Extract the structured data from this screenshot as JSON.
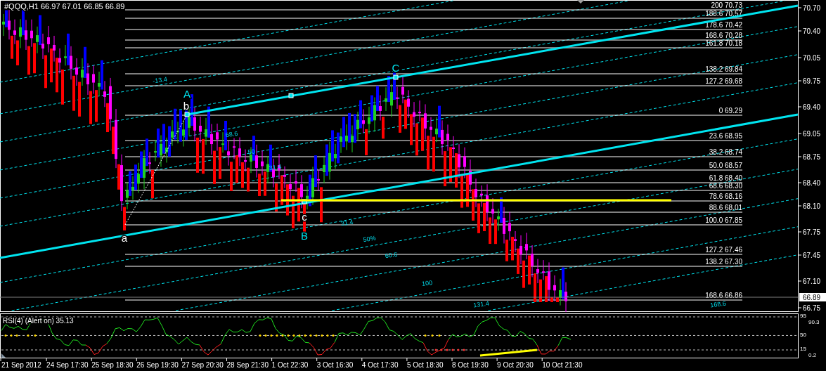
{
  "chart": {
    "symbol": "#QQQ,H1",
    "quotes": "66.97 67.01 66.85 66.89",
    "fib_levels": [
      {
        "label": "200 70.73"
      },
      {
        "label": "188.6 70.57"
      },
      {
        "label": "178.6 70.42"
      },
      {
        "label": "168.6 70.28"
      },
      {
        "label": "161.8 70.18"
      },
      {
        "label": "138.2 69.84"
      },
      {
        "label": "127.2 69.68"
      },
      {
        "label": "0 69.29"
      },
      {
        "label": "23.6 68.95"
      },
      {
        "label": "38.2 68.74"
      },
      {
        "label": "50.0 68.57"
      },
      {
        "label": "61.8 68.40"
      },
      {
        "label": "68.6 68.30"
      },
      {
        "label": "78.6 68.16"
      },
      {
        "label": "88.6 68.01"
      },
      {
        "label": "100.0 67.85"
      },
      {
        "label": "127.2 67.46"
      },
      {
        "label": "138.2 67.30"
      },
      {
        "label": "168.6 66.86"
      }
    ],
    "price_axis": [
      "70.70",
      "70.40",
      "70.05",
      "69.75",
      "69.40",
      "69.05",
      "68.75",
      "68.40",
      "68.10",
      "67.75",
      "67.45",
      "67.10",
      "66.75"
    ],
    "current_price": "66.89",
    "wave_labels": [
      {
        "text": "A",
        "kind": "major"
      },
      {
        "text": "b",
        "kind": "minor"
      },
      {
        "text": "C",
        "kind": "major"
      },
      {
        "text": "c",
        "kind": "minor"
      },
      {
        "text": "B",
        "kind": "major"
      },
      {
        "text": "a",
        "kind": "minor"
      }
    ],
    "channel_labels": [
      "-13.4",
      "68.6",
      "50",
      "31.4",
      "31.4",
      "50%",
      "60.6",
      "100",
      "131.4",
      "168.6"
    ],
    "time_axis": [
      "21 Sep 2012",
      "24 Sep 17:30",
      "25 Sep 18:30",
      "26 Sep 19:30",
      "27 Sep 20:30",
      "28 Sep 21:30",
      "1 Oct 22:30",
      "3 Oct 16:30",
      "4 Oct 17:30",
      "5 Oct 18:30",
      "8 Oct 19:30",
      "9 Oct 20:30",
      "10 Oct 21:30"
    ]
  },
  "rsi": {
    "title": "RSI(4) (Alert on) 35.13",
    "axis": [
      "95",
      "90.3",
      "50",
      "15",
      "0.2"
    ]
  }
}
